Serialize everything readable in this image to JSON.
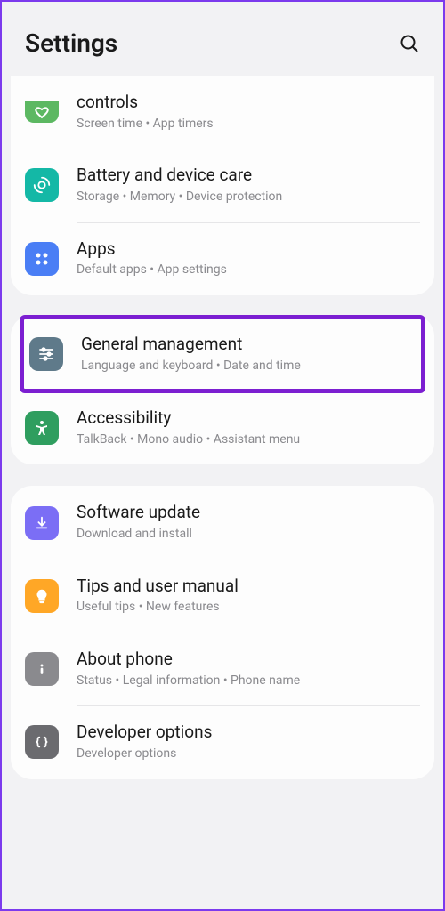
{
  "header": {
    "title": "Settings"
  },
  "groups": [
    {
      "items": [
        {
          "icon": "heart",
          "color": "ic-green",
          "title": "controls",
          "sub": "Screen time  •  App timers",
          "partial": true
        },
        {
          "icon": "care",
          "color": "ic-teal",
          "title": "Battery and device care",
          "sub": "Storage  •  Memory  •  Device protection"
        },
        {
          "icon": "apps",
          "color": "ic-blue",
          "title": "Apps",
          "sub": "Default apps  •  App settings"
        }
      ]
    },
    {
      "items": [
        {
          "icon": "sliders",
          "color": "ic-slate",
          "title": "General management",
          "sub": "Language and keyboard  •  Date and time",
          "highlighted": true
        },
        {
          "icon": "accessibility",
          "color": "ic-green2",
          "title": "Accessibility",
          "sub": "TalkBack  •  Mono audio  •  Assistant menu"
        }
      ]
    },
    {
      "items": [
        {
          "icon": "update",
          "color": "ic-purple",
          "title": "Software update",
          "sub": "Download and install"
        },
        {
          "icon": "tips",
          "color": "ic-orange",
          "title": "Tips and user manual",
          "sub": "Useful tips  •  New features"
        },
        {
          "icon": "info",
          "color": "ic-gray",
          "title": "About phone",
          "sub": "Status  •  Legal information  •  Phone name"
        },
        {
          "icon": "dev",
          "color": "ic-gray2",
          "title": "Developer options",
          "sub": "Developer options"
        }
      ]
    }
  ]
}
